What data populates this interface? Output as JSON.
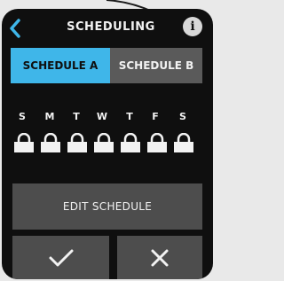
{
  "header": {
    "title": "SCHEDULING",
    "info_glyph": "i"
  },
  "tabs": [
    {
      "label": "SCHEDULE A",
      "active": true
    },
    {
      "label": "SCHEDULE B",
      "active": false
    }
  ],
  "days": [
    "S",
    "M",
    "T",
    "W",
    "T",
    "F",
    "S"
  ],
  "actions": {
    "edit_label": "EDIT SCHEDULE"
  },
  "icons": {
    "back": "back-chevron-icon",
    "info": "info-icon",
    "lock": "lock-icon",
    "confirm": "checkmark-icon",
    "cancel": "close-x-icon"
  },
  "colors": {
    "accent": "#3fb6e9",
    "background": "#0f0f0f",
    "button": "#4d4d4d",
    "inactive_tab": "#5a5a5a"
  }
}
